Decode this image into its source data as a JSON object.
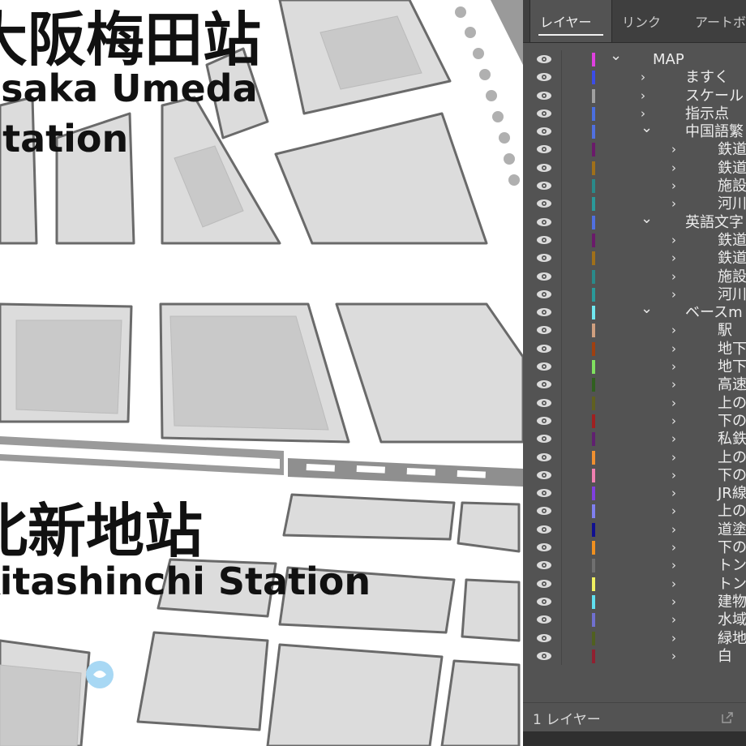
{
  "map": {
    "stations": [
      {
        "jp": "大阪梅田站",
        "en": "Osaka Umeda",
        "en2": "Station"
      },
      {
        "jp": "北新地站",
        "en": "Kitashinchi Station"
      }
    ]
  },
  "panel": {
    "tabs": [
      {
        "label": "レイヤー",
        "active": true
      },
      {
        "label": "リンク",
        "active": false
      },
      {
        "label": "アートボ",
        "active": false
      }
    ],
    "layers": [
      {
        "name": "MAP",
        "level": 0,
        "expanded": true,
        "color": "#e040e0"
      },
      {
        "name": "ますく",
        "level": 1,
        "expanded": false,
        "color": "#3b4de8"
      },
      {
        "name": "スケール",
        "level": 1,
        "expanded": false,
        "color": "#a0a0a0"
      },
      {
        "name": "指示点",
        "level": 1,
        "expanded": false,
        "color": "#4a6fe0"
      },
      {
        "name": "中国語繁",
        "level": 1,
        "expanded": true,
        "color": "#5070e0"
      },
      {
        "name": "鉄道",
        "level": 2,
        "expanded": false,
        "color": "#6a1a6a"
      },
      {
        "name": "鉄道",
        "level": 2,
        "expanded": false,
        "color": "#a0701a"
      },
      {
        "name": "施設",
        "level": 2,
        "expanded": false,
        "color": "#2a8a8a"
      },
      {
        "name": "河川",
        "level": 2,
        "expanded": false,
        "color": "#2a9a9a"
      },
      {
        "name": "英語文字",
        "level": 1,
        "expanded": true,
        "color": "#5070e0"
      },
      {
        "name": "鉄道",
        "level": 2,
        "expanded": false,
        "color": "#6a1a6a"
      },
      {
        "name": "鉄道",
        "level": 2,
        "expanded": false,
        "color": "#a0701a"
      },
      {
        "name": "施設",
        "level": 2,
        "expanded": false,
        "color": "#2a8a8a"
      },
      {
        "name": "河川",
        "level": 2,
        "expanded": false,
        "color": "#2a9a9a"
      },
      {
        "name": "ベースm",
        "level": 1,
        "expanded": true,
        "color": "#70e8f0"
      },
      {
        "name": "駅",
        "level": 2,
        "expanded": false,
        "color": "#d0a080"
      },
      {
        "name": "地下",
        "level": 2,
        "expanded": false,
        "color": "#a04010"
      },
      {
        "name": "地下",
        "level": 2,
        "expanded": false,
        "color": "#80e060"
      },
      {
        "name": "高速",
        "level": 2,
        "expanded": false,
        "color": "#306020"
      },
      {
        "name": "上の",
        "level": 2,
        "expanded": false,
        "color": "#606020"
      },
      {
        "name": "下の",
        "level": 2,
        "expanded": false,
        "color": "#a02020"
      },
      {
        "name": "私鉄",
        "level": 2,
        "expanded": false,
        "color": "#602070"
      },
      {
        "name": "上の",
        "level": 2,
        "expanded": false,
        "color": "#f09030"
      },
      {
        "name": "下の",
        "level": 2,
        "expanded": false,
        "color": "#f080b0"
      },
      {
        "name": "JR線",
        "level": 2,
        "expanded": false,
        "color": "#8040e0"
      },
      {
        "name": "上の",
        "level": 2,
        "expanded": false,
        "color": "#8080f0"
      },
      {
        "name": "道塗",
        "level": 2,
        "expanded": false,
        "color": "#101090"
      },
      {
        "name": "下の",
        "level": 2,
        "expanded": false,
        "color": "#f09020"
      },
      {
        "name": "トン",
        "level": 2,
        "expanded": false,
        "color": "#707070"
      },
      {
        "name": "トン",
        "level": 2,
        "expanded": false,
        "color": "#f0f060"
      },
      {
        "name": "建物",
        "level": 2,
        "expanded": false,
        "color": "#60e0f0"
      },
      {
        "name": "水域",
        "level": 2,
        "expanded": false,
        "color": "#7070d0"
      },
      {
        "name": "緑地",
        "level": 2,
        "expanded": false,
        "color": "#506020"
      },
      {
        "name": "白",
        "level": 2,
        "expanded": false,
        "color": "#902030"
      }
    ],
    "footer": {
      "count_label": "1 レイヤー"
    }
  }
}
